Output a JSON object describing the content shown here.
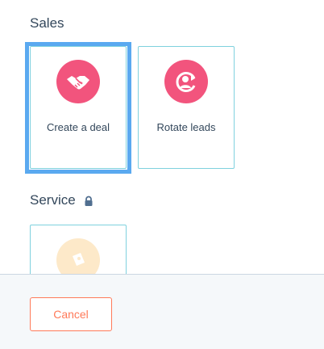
{
  "sections": {
    "sales": {
      "title": "Sales",
      "cards": [
        {
          "label": "Create a deal",
          "icon": "handshake-icon"
        },
        {
          "label": "Rotate leads",
          "icon": "rotate-user-icon"
        }
      ]
    },
    "service": {
      "title": "Service",
      "lock_icon": "lock-icon",
      "cards": [
        {
          "label": "",
          "icon": "ticket-icon"
        }
      ]
    }
  },
  "footer": {
    "cancel_label": "Cancel"
  },
  "colors": {
    "accent_pink": "#f2547d",
    "card_border": "#7fd1de",
    "focus": "#5aa9f0",
    "cancel": "#ff7a59",
    "ticket_faded": "#fde9c9"
  }
}
